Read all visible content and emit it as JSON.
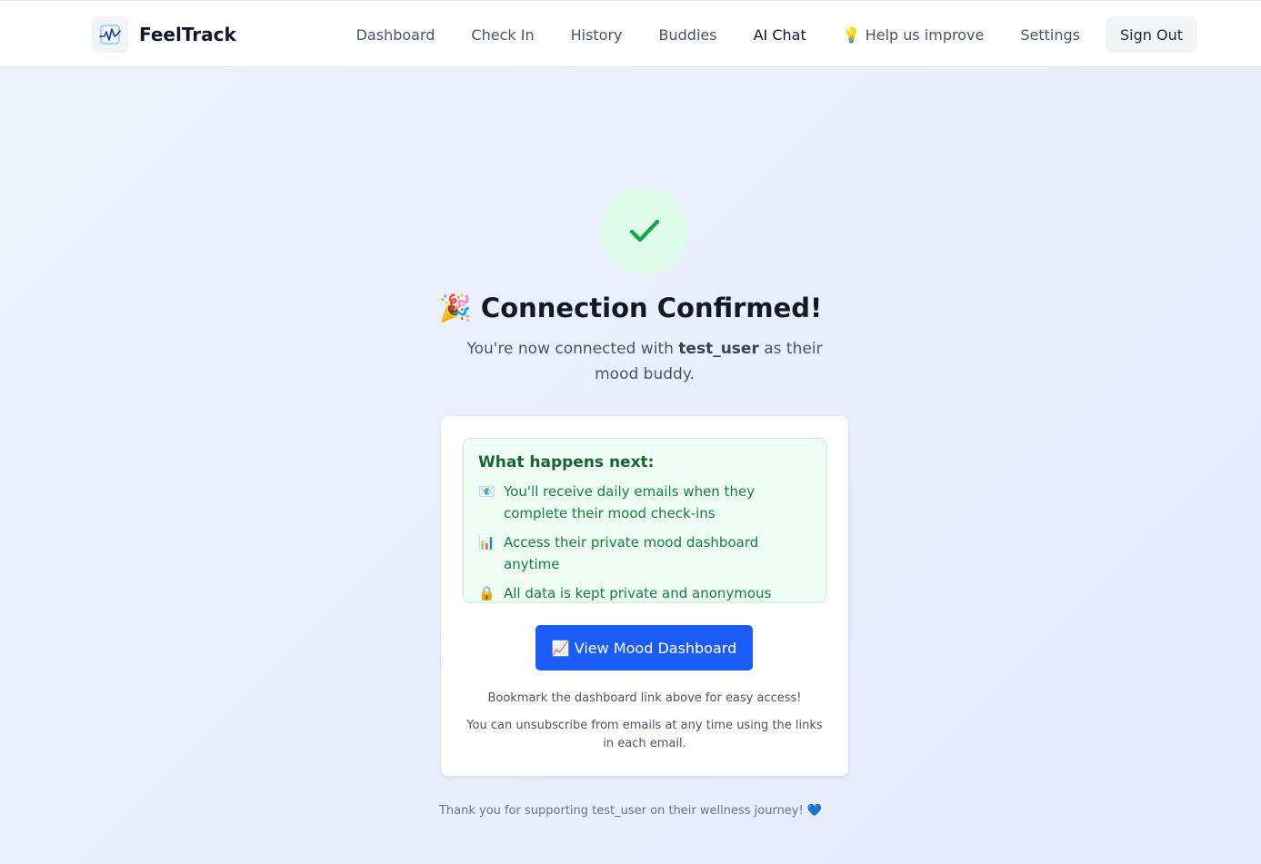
{
  "app": {
    "name": "FeelTrack",
    "logo_icon": "heartbeat-chart-icon"
  },
  "nav": {
    "items": [
      {
        "label": "Dashboard"
      },
      {
        "label": "Check In"
      },
      {
        "label": "History"
      },
      {
        "label": "Buddies"
      },
      {
        "label": "AI Chat"
      },
      {
        "label": "💡 Help us improve"
      },
      {
        "label": "Settings"
      }
    ],
    "active_item": "AI Chat",
    "signout_label": "Sign Out"
  },
  "confirmation": {
    "icon": "checkmark-icon",
    "title": "🎉 Connection Confirmed!",
    "subtitle_prefix": "You're now connected with ",
    "username": "test_user",
    "subtitle_suffix": " as their mood buddy."
  },
  "next_steps": {
    "heading": "What happens next:",
    "items": [
      {
        "icon": "📧",
        "icon_name": "email-icon",
        "text": "You'll receive daily emails when they complete their mood check-ins"
      },
      {
        "icon": "📊",
        "icon_name": "bar-chart-icon",
        "text": "Access their private mood dashboard anytime"
      },
      {
        "icon": "🔒",
        "icon_name": "lock-icon",
        "text": "All data is kept private and anonymous"
      }
    ]
  },
  "cta": {
    "label": "📈 View Mood Dashboard"
  },
  "notes": {
    "bookmark": "Bookmark the dashboard link above for easy access!",
    "unsubscribe": "You can unsubscribe from emails at any time using the links in each email."
  },
  "footer": {
    "text": "Thank you for supporting test_user on their wellness journey! 💙"
  },
  "colors": {
    "primary": "#1c5cf6",
    "success": "#16a34a",
    "success_bg": "#f0fdf4",
    "background": "#eef3fd"
  }
}
